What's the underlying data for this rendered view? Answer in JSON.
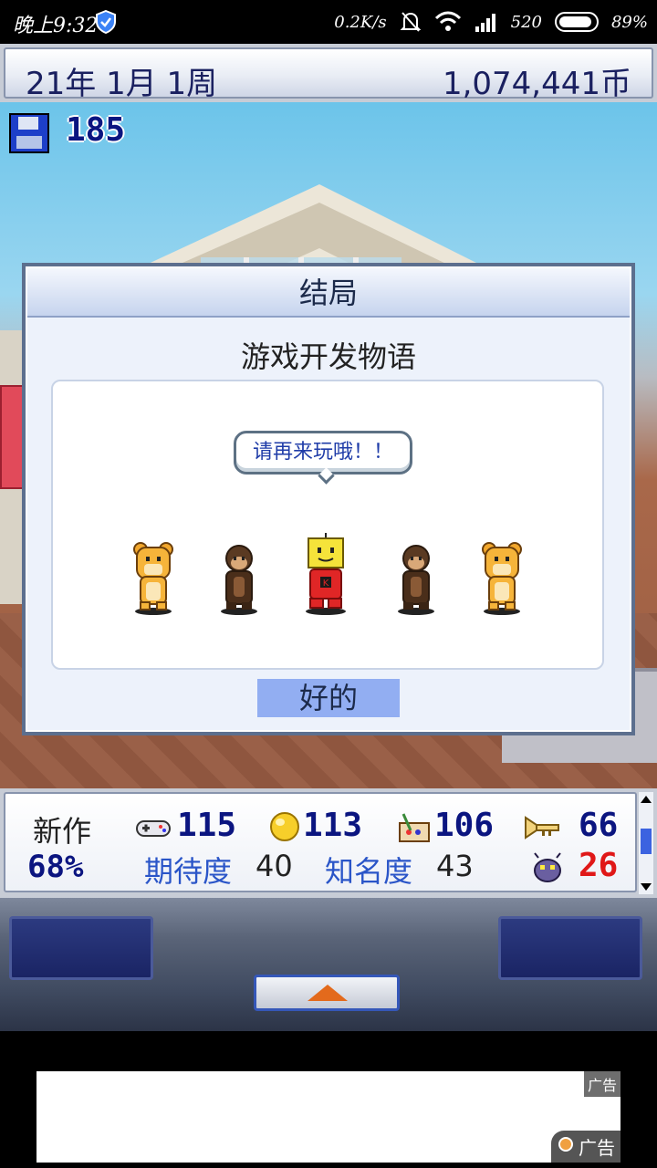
{
  "status_bar": {
    "time": "晚上9:32",
    "net_speed": "0.2K/s",
    "extra": "520",
    "battery": "89%"
  },
  "header": {
    "date": "21年 1月 1周",
    "coins": "1,074,441币"
  },
  "save": {
    "count": "185"
  },
  "dialog": {
    "title": "结局",
    "subtitle": "游戏开发物语",
    "speech": "请再来玩哦！！",
    "ok_label": "好的",
    "characters": [
      "bear-mascot",
      "monkey",
      "kairobot",
      "monkey",
      "bear-mascot"
    ]
  },
  "panel": {
    "label": "新作",
    "percent": "68%",
    "stats": {
      "fun": "115",
      "creativity": "113",
      "graphics": "106",
      "sound": "66"
    },
    "expectation_label": "期待度",
    "expectation_value": "40",
    "fame_label": "知名度",
    "fame_value": "43",
    "bugs": "26"
  },
  "ad": {
    "tag": "广告",
    "badge": "广告"
  },
  "colors": {
    "accent": "#0b1580",
    "bug": "#e01818",
    "ok_button": "#92aef2"
  }
}
